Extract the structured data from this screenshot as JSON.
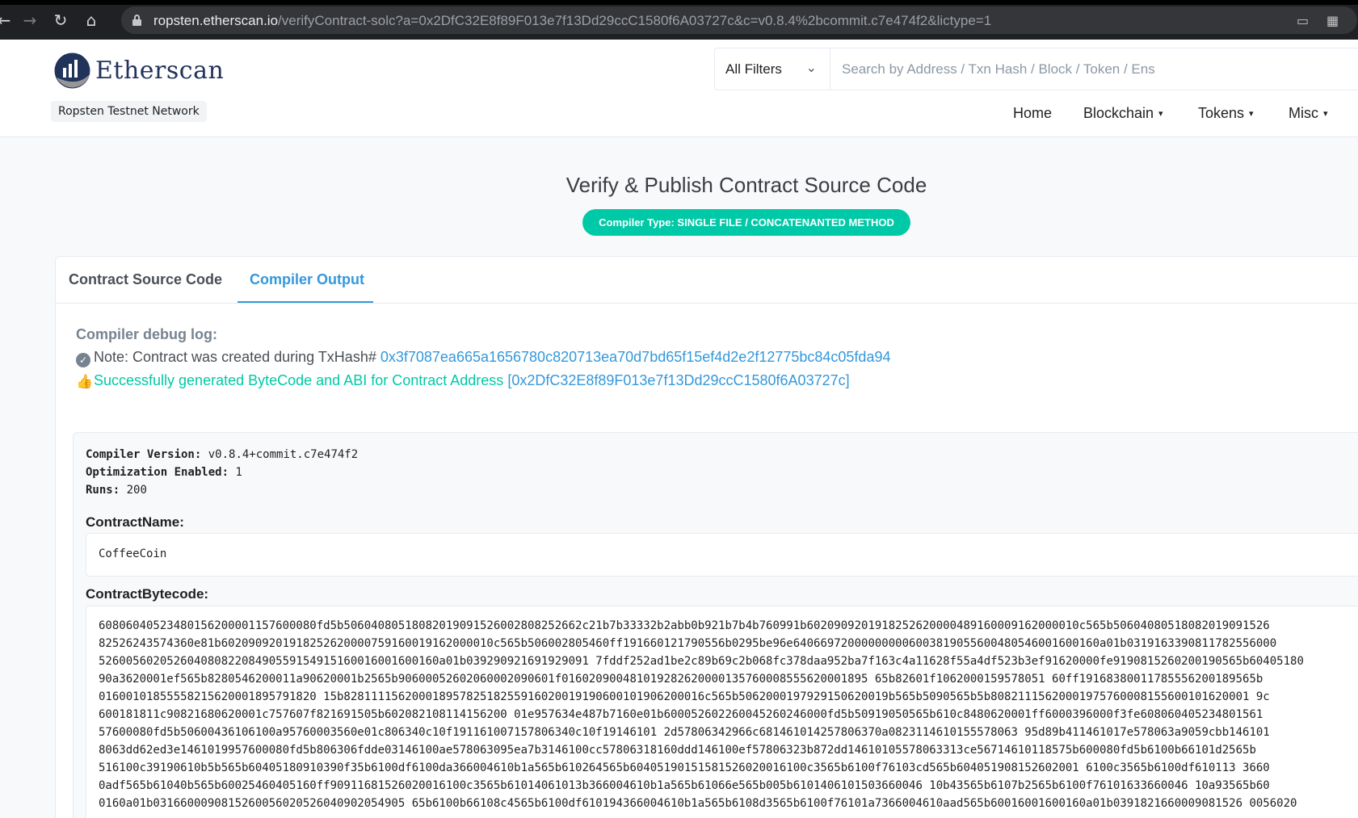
{
  "browser": {
    "url_host": "ropsten.etherscan.io",
    "url_path": "/verifyContract-solc?a=0x2DfC32E8f89F013e7f13Dd29ccC1580f6A03727c&c=v0.8.4%2bcommit.c7e474f2&lictype=1"
  },
  "header": {
    "logo_text": "Etherscan",
    "network": "Ropsten Testnet Network",
    "filter_label": "All Filters",
    "search_placeholder": "Search by Address / Txn Hash / Block / Token / Ens",
    "menu": [
      "Home",
      "Blockchain",
      "Tokens",
      "Misc"
    ]
  },
  "main": {
    "title": "Verify & Publish Contract Source Code",
    "compiler_badge": "Compiler Type: SINGLE FILE / CONCATENANTED METHOD",
    "tabs": [
      "Contract Source Code",
      "Compiler Output"
    ],
    "active_tab": "Compiler Output",
    "debug_title": "Compiler debug log:",
    "note_prefix": "Note: Contract was created during TxHash#",
    "note_txhash": "0x3f7087ea665a1656780c820713ea70d7bd65f15ef4d2e2f12775bc84c05fda94",
    "success_text": "Successfully generated ByteCode and ABI for Contract Address",
    "success_address": "[0x2DfC32E8f89F013e7f13Dd29ccC1580f6A03727c]",
    "compiler_version_label": "Compiler Version:",
    "compiler_version": "v0.8.4+commit.c7e474f2",
    "optimization_label": "Optimization Enabled:",
    "optimization": "1",
    "runs_label": "Runs:",
    "runs": "200",
    "contract_name_label": "ContractName:",
    "contract_name": "CoffeeCoin",
    "bytecode_label": "ContractBytecode:",
    "bytecode_lines": [
      "60806040523480156200001157600080fd5b50604080518082019091526002808252662c21b7b33332b2abb0b921b7b4b760991b6020909201918252620000489160009162000010c565b50604080518082019091526",
      "82526243574360e81b6020909201918252620000759160019162000010c565b506002805460ff191660121790556b0295be96e640669720000000006003819055600480546001600160a01b0319163390811782556000",
      "52600560205260408082208490559154915160016001600160a01b039290921691929091 7fddf252ad1be2c89b69c2b068fc378daa952ba7f163c4a11628f55a4df523b3ef91620000fe9190815260200190565b60405180",
      "90a3620001ef565b8280546200011a90620001b2565b90600052602060002090601f016020900481019282620000135760008555620001895 65b82601f1062000159578051 60ff19168380011785556200189565b",
      "01600101855558215620001895791820 15b82811115620001895782518255916020019190600101906200016c565b5062000197929150620019b565b5090565b5b80821115620001975760008155600101620001 9c",
      "600181811c90821680620001c757607f821691505b602082108114156200 01e957634e487b7160e01b600052602260045260246000fd5b50919050565b610c8480620001ff6000396000f3fe608060405234801561",
      "57600080fd5b50600436106100a95760003560e01c806340c10f191161007157806340c10f19146101 2d57806342966c681461014257806370a0823114610155578063 95d89b411461017e578063a9059cbb146101",
      "8063dd62ed3e1461019957600080fd5b806306fdde03146100ae578063095ea7b3146100cc57806318160ddd146100ef57806323b872dd14610105578063313ce56714610118575b600080fd5b6100b66101d2565b",
      "516100c39190610b5b565b60405180910390f35b6100df6100da366004610b1a565b610264565b60405190151581526020016100c3565b6100f76103cd565b604051908152602001 6100c3565b6100df610113 3660",
      "0adf565b61040b565b60025460405160ff90911681526020016100c3565b61014061013b366004610b1a565b61066e565b005b6101406101503660046 10b43565b6107b2565b6100f76101633660046 10a93565b60",
      "0160a01b0316600090815260056020526040902054905 65b6100b66108c4565b6100df610194366004610b1a565b6108d3565b6100f76101a7366004610aad565b60016001600160a01b0391821660009081526 0056020"
    ]
  }
}
